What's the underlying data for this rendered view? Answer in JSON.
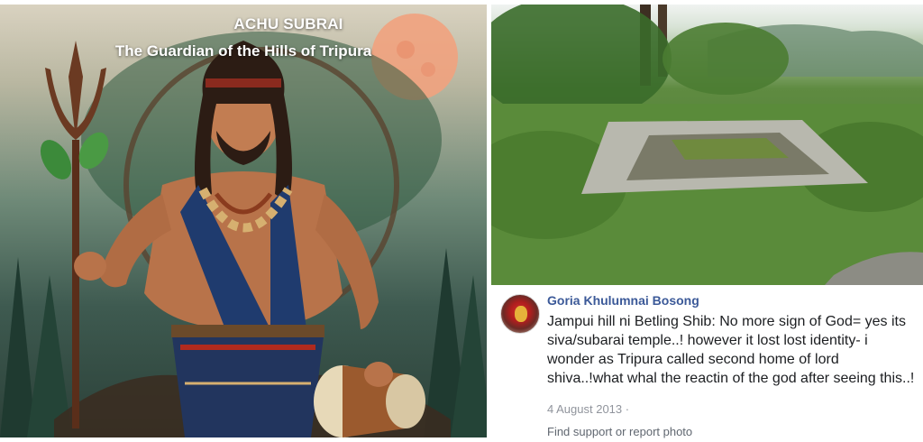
{
  "illustration": {
    "title": "ACHU SUBRAI",
    "subtitle": "The Guardian of the Hills of Tripura"
  },
  "post": {
    "author": "Goria Khulumnai Bosong",
    "text": "Jampui hill ni Betling Shib: No more sign of God= yes its siva/subarai temple..! however it lost lost identity- i wonder as Tripura called second home of lord shiva..!what whal the reactin of the god after seeing this..!",
    "date": "4 August 2013 ·",
    "action_link": "Find support or report photo"
  }
}
